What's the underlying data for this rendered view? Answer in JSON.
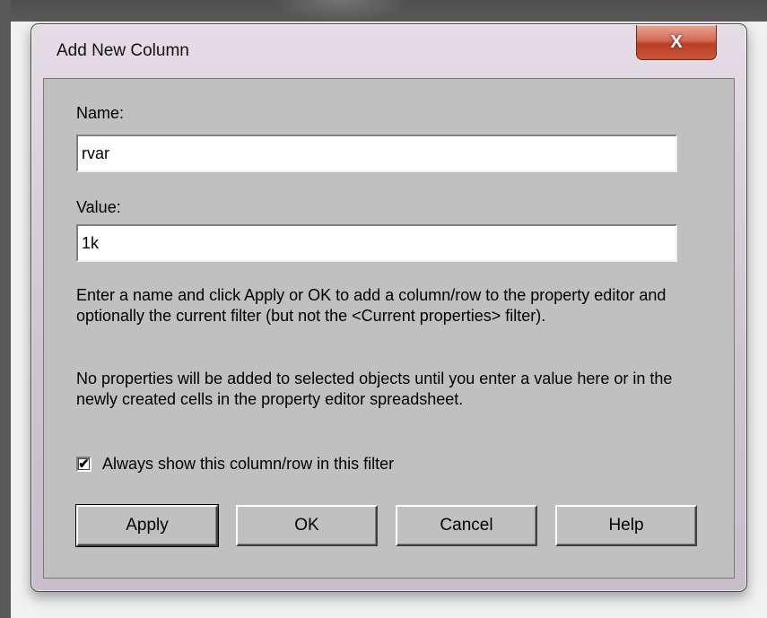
{
  "window": {
    "title": "Add New Column",
    "close_glyph": "X"
  },
  "form": {
    "name_label": "Name:",
    "name_value": "rvar",
    "value_label": "Value:",
    "value_value": "1k",
    "help_text_1": "Enter a name and click Apply or OK to add a column/row to the property editor and optionally the current filter (but not the <Current properties> filter).",
    "help_text_2": "No properties will be added to selected objects until you enter a value here or in the newly created cells in the property editor spreadsheet.",
    "checkbox_label": "Always show this column/row in this filter",
    "checkbox_checked": true,
    "checkbox_glyph": "✔"
  },
  "buttons": {
    "apply": "Apply",
    "ok": "OK",
    "cancel": "Cancel",
    "help": "Help"
  }
}
